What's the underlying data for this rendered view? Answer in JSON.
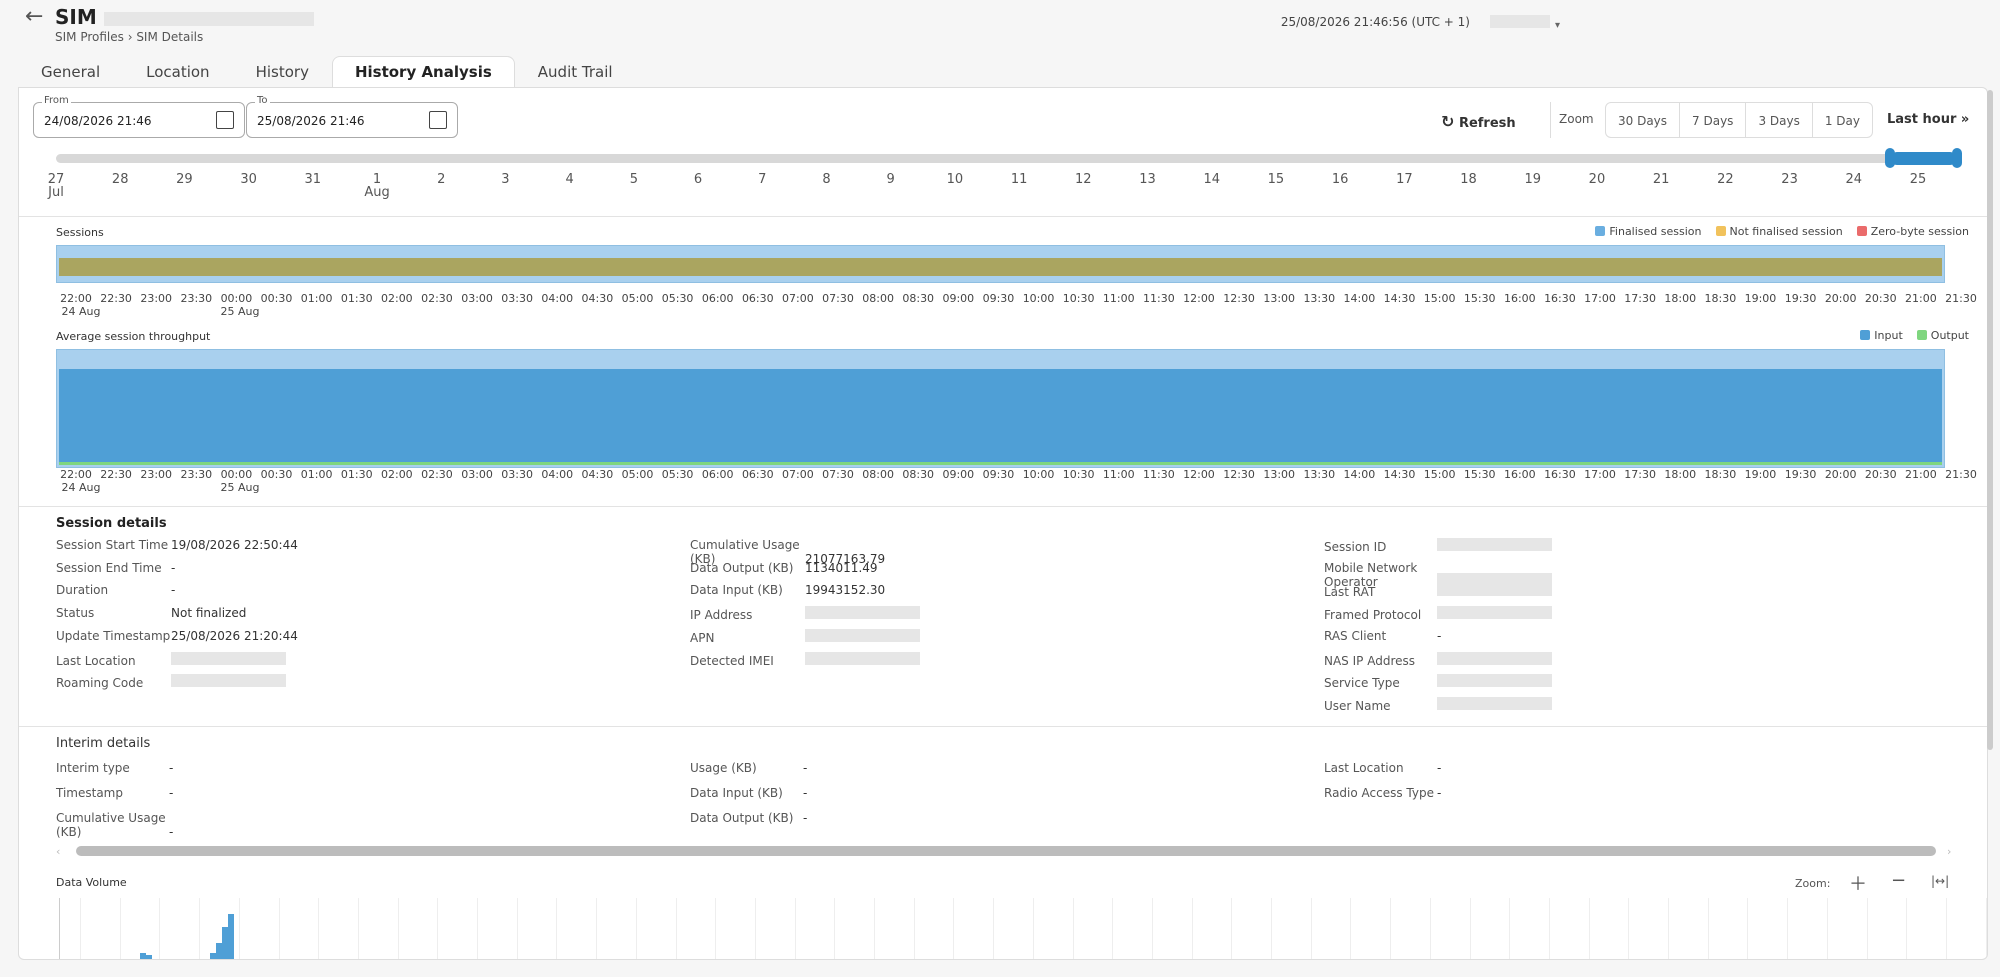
{
  "header": {
    "title": "SIM",
    "breadcrumb": "SIM Profiles › SIM Details",
    "timestamp": "25/08/2026 21:46:56 (UTC + 1)"
  },
  "tabs": [
    "General",
    "Location",
    "History",
    "History Analysis",
    "Audit Trail"
  ],
  "active_tab": "History Analysis",
  "filters": {
    "from_label": "From",
    "from_value": "24/08/2026 21:46",
    "to_label": "To",
    "to_value": "25/08/2026 21:46"
  },
  "toolbar": {
    "refresh": "Refresh",
    "zoom_label": "Zoom",
    "zoom_options": [
      "30 Days",
      "7 Days",
      "3 Days",
      "1 Day"
    ],
    "last_hour": "Last hour"
  },
  "timeline": {
    "ticks": [
      "27",
      "28",
      "29",
      "30",
      "31",
      "1",
      "2",
      "3",
      "4",
      "5",
      "6",
      "7",
      "8",
      "9",
      "10",
      "11",
      "12",
      "13",
      "14",
      "15",
      "16",
      "17",
      "18",
      "19",
      "20",
      "21",
      "22",
      "23",
      "24",
      "25"
    ],
    "month_labels": {
      "27": "Jul",
      "1": "Aug"
    }
  },
  "sessions": {
    "title": "Sessions",
    "legend": [
      {
        "label": "Finalised session",
        "color": "#6aaee0"
      },
      {
        "label": "Not finalised session",
        "color": "#f1c25c"
      },
      {
        "label": "Zero-byte session",
        "color": "#ea6b6b"
      }
    ]
  },
  "throughput": {
    "title": "Average session throughput",
    "legend": [
      {
        "label": "Input",
        "color": "#4f9fd6"
      },
      {
        "label": "Output",
        "color": "#7fd67f"
      }
    ]
  },
  "time_axis": {
    "ticks": [
      "22:00",
      "22:30",
      "23:00",
      "23:30",
      "00:00",
      "00:30",
      "01:00",
      "01:30",
      "02:00",
      "02:30",
      "03:00",
      "03:30",
      "04:00",
      "04:30",
      "05:00",
      "05:30",
      "06:00",
      "06:30",
      "07:00",
      "07:30",
      "08:00",
      "08:30",
      "09:00",
      "09:30",
      "10:00",
      "10:30",
      "11:00",
      "11:30",
      "12:00",
      "12:30",
      "13:00",
      "13:30",
      "14:00",
      "14:30",
      "15:00",
      "15:30",
      "16:00",
      "16:30",
      "17:00",
      "17:30",
      "18:00",
      "18:30",
      "19:00",
      "19:30",
      "20:00",
      "20:30",
      "21:00",
      "21:30"
    ],
    "day1": "24 Aug",
    "day2": "25 Aug"
  },
  "session_details": {
    "title": "Session details",
    "col1": [
      [
        "Session Start Time",
        "19/08/2026 22:50:44"
      ],
      [
        "Session End Time",
        "-"
      ],
      [
        "Duration",
        "-"
      ],
      [
        "Status",
        "Not finalized"
      ],
      [
        "Update Timestamp",
        "25/08/2026 21:20:44"
      ],
      [
        "Last Location",
        ""
      ],
      [
        "Roaming Code",
        ""
      ]
    ],
    "col2": [
      [
        "Cumulative Usage (KB)",
        "21077163.79"
      ],
      [
        "Data Output (KB)",
        "1134011.49"
      ],
      [
        "Data Input (KB)",
        "19943152.30"
      ],
      [
        "IP Address",
        ""
      ],
      [
        "APN",
        ""
      ],
      [
        "Detected IMEI",
        ""
      ]
    ],
    "col3": [
      [
        "Session ID",
        ""
      ],
      [
        "Mobile Network Operator",
        ""
      ],
      [
        "Last RAT",
        ""
      ],
      [
        "Framed Protocol",
        ""
      ],
      [
        "RAS Client",
        "-"
      ],
      [
        "NAS IP Address",
        ""
      ],
      [
        "Service Type",
        ""
      ],
      [
        "User Name",
        ""
      ]
    ]
  },
  "interim_details": {
    "title": "Interim details",
    "col1": [
      [
        "Interim type",
        "-"
      ],
      [
        "Timestamp",
        "-"
      ],
      [
        "Cumulative Usage (KB)",
        "-"
      ]
    ],
    "col2": [
      [
        "Usage (KB)",
        "-"
      ],
      [
        "Data Input (KB)",
        "-"
      ],
      [
        "Data Output (KB)",
        "-"
      ]
    ],
    "col3": [
      [
        "Last Location",
        "-"
      ],
      [
        "Radio Access Type",
        "-"
      ]
    ]
  },
  "data_volume": {
    "title": "Data Volume",
    "zoom_label": "Zoom:"
  }
}
